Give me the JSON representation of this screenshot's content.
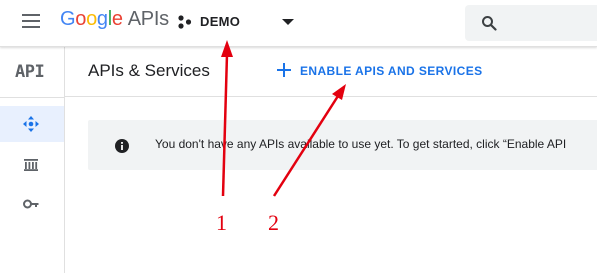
{
  "header": {
    "logo_letters": [
      "G",
      "o",
      "o",
      "g",
      "l",
      "e"
    ],
    "logo_suffix": "APIs",
    "project_name": "DEMO"
  },
  "rail": {
    "title": "API",
    "items": [
      {
        "name": "dashboard",
        "icon": "move-arrows-icon",
        "active": true
      },
      {
        "name": "library",
        "icon": "library-icon",
        "active": false
      },
      {
        "name": "credentials",
        "icon": "key-icon",
        "active": false
      }
    ]
  },
  "main": {
    "title": "APIs & Services",
    "enable_label": "ENABLE APIS AND SERVICES",
    "notice_text": "You don't have any APIs available to use yet. To get started, click “Enable API"
  },
  "annotations": {
    "labels": [
      "1",
      "2"
    ],
    "color": "#e3000f"
  },
  "colors": {
    "accent": "#1a73e8",
    "active_bg": "#e8f0fe"
  }
}
